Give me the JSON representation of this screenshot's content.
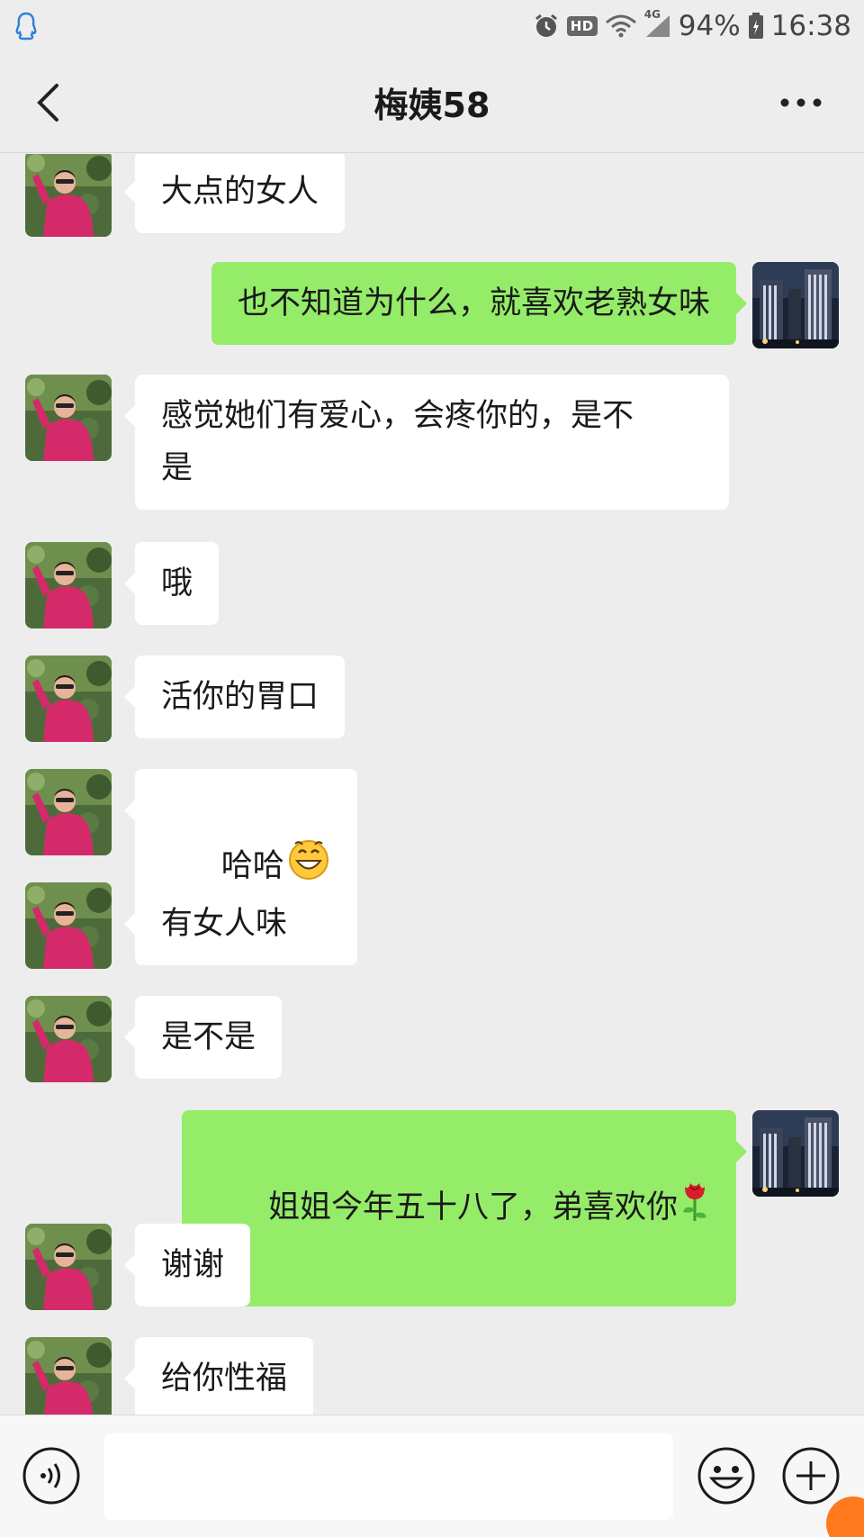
{
  "status_bar": {
    "battery": "94%",
    "time": "16:38",
    "network": "4G",
    "hd": "HD",
    "icons": [
      "qq-icon",
      "alarm-icon",
      "hd-icon",
      "wifi-icon",
      "signal-icon",
      "battery-icon"
    ]
  },
  "header": {
    "title": "梅姨58",
    "back_icon": "chevron-left-icon",
    "more_icon": "more-dots-icon"
  },
  "messages": [
    {
      "side": "in",
      "text": "大点的女人"
    },
    {
      "side": "out",
      "text": "也不知道为什么，就喜欢老熟女味"
    },
    {
      "side": "in",
      "text": "感觉她们有爱心，会疼你的，是不\n是"
    },
    {
      "side": "in",
      "text": "哦"
    },
    {
      "side": "in",
      "text": "活你的胃口"
    },
    {
      "side": "in",
      "text": "哈哈",
      "emoji": "grinning-face-emoji"
    },
    {
      "side": "in",
      "text": "有女人味"
    },
    {
      "side": "in",
      "text": "是不是"
    },
    {
      "side": "out",
      "text": "姐姐今年五十八了，弟喜欢你",
      "emoji": "rose-emoji"
    },
    {
      "side": "in",
      "text": "谢谢"
    },
    {
      "side": "in",
      "text": "给你性福"
    }
  ],
  "input_bar": {
    "placeholder": "",
    "icons": [
      "voice-icon",
      "emoji-icon",
      "plus-icon"
    ]
  },
  "colors": {
    "background": "#ededed",
    "outgoing_bubble": "#95ec69",
    "incoming_bubble": "#ffffff",
    "avatar_in": "#d42a6a",
    "avatar_out": "#1b2233"
  }
}
